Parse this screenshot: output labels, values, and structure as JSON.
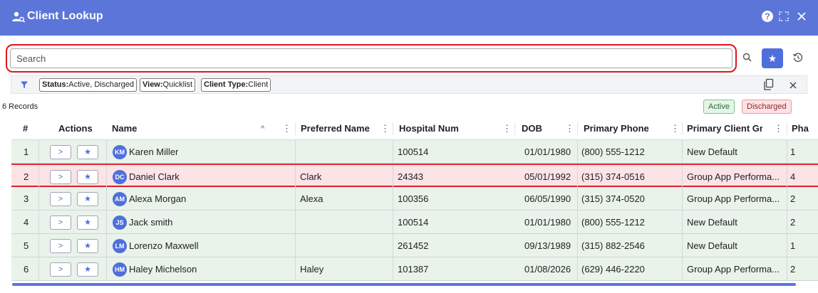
{
  "window": {
    "title": "Client Lookup",
    "title_icon": "user-search-icon",
    "help_label": "?",
    "icons": {
      "help": "help-icon",
      "expand": "expand-icon",
      "close": "close-icon"
    },
    "accent_color": "#5b76d8"
  },
  "search": {
    "placeholder": "Search",
    "value": "",
    "icons": {
      "search": "search-icon",
      "favorites": "star-icon",
      "history": "history-icon"
    }
  },
  "filters": {
    "chips": [
      {
        "key": "Status:",
        "value": "Active, Discharged"
      },
      {
        "key": "View:",
        "value": "Quicklist"
      },
      {
        "key": "Client Type:",
        "value": "Client"
      }
    ],
    "icons": {
      "filter": "filter-icon",
      "copy": "copy-icon",
      "clear": "clear-icon"
    }
  },
  "summary": {
    "records": "6 Records"
  },
  "legend": {
    "active": "Active",
    "discharged": "Discharged",
    "active_color": "#e9f3ea",
    "discharged_color": "#fbe3e6"
  },
  "table": {
    "columns": [
      "#",
      "Actions",
      "Name",
      "Preferred Name",
      "Hospital Num",
      "DOB",
      "Primary Phone",
      "Primary Client Gr",
      "Pha"
    ],
    "sort_indicator": "^",
    "menu_glyph": "⋮",
    "action_labels": {
      "open": ">",
      "favorite": "★"
    },
    "rows": [
      {
        "num": "1",
        "initials": "KM",
        "name": "Karen Miller",
        "preferred": "",
        "hospital": "100514",
        "dob": "01/01/1980",
        "phone": "(800) 555-1212",
        "group": "New Default",
        "pha": "1",
        "status": "active"
      },
      {
        "num": "2",
        "initials": "DC",
        "name": "Daniel Clark",
        "preferred": "Clark",
        "hospital": "24343",
        "dob": "05/01/1992",
        "phone": "(315) 374-0516",
        "group": "Group App Performa...",
        "pha": "4",
        "status": "discharged"
      },
      {
        "num": "3",
        "initials": "AM",
        "name": "Alexa Morgan",
        "preferred": "Alexa",
        "hospital": "100356",
        "dob": "06/05/1990",
        "phone": "(315) 374-0520",
        "group": "Group App Performa...",
        "pha": "2",
        "status": "active"
      },
      {
        "num": "4",
        "initials": "JS",
        "name": "Jack smith",
        "preferred": "",
        "hospital": "100514",
        "dob": "01/01/1980",
        "phone": "(800) 555-1212",
        "group": "New Default",
        "pha": "2",
        "status": "active"
      },
      {
        "num": "5",
        "initials": "LM",
        "name": "Lorenzo Maxwell",
        "preferred": "",
        "hospital": "261452",
        "dob": "09/13/1989",
        "phone": "(315) 882-2546",
        "group": "New Default",
        "pha": "1",
        "status": "active"
      },
      {
        "num": "6",
        "initials": "HM",
        "name": "Haley Michelson",
        "preferred": "Haley",
        "hospital": "101387",
        "dob": "01/08/2026",
        "phone": "(629) 446-2220",
        "group": "Group App Performa...",
        "pha": "2",
        "status": "active"
      }
    ]
  }
}
